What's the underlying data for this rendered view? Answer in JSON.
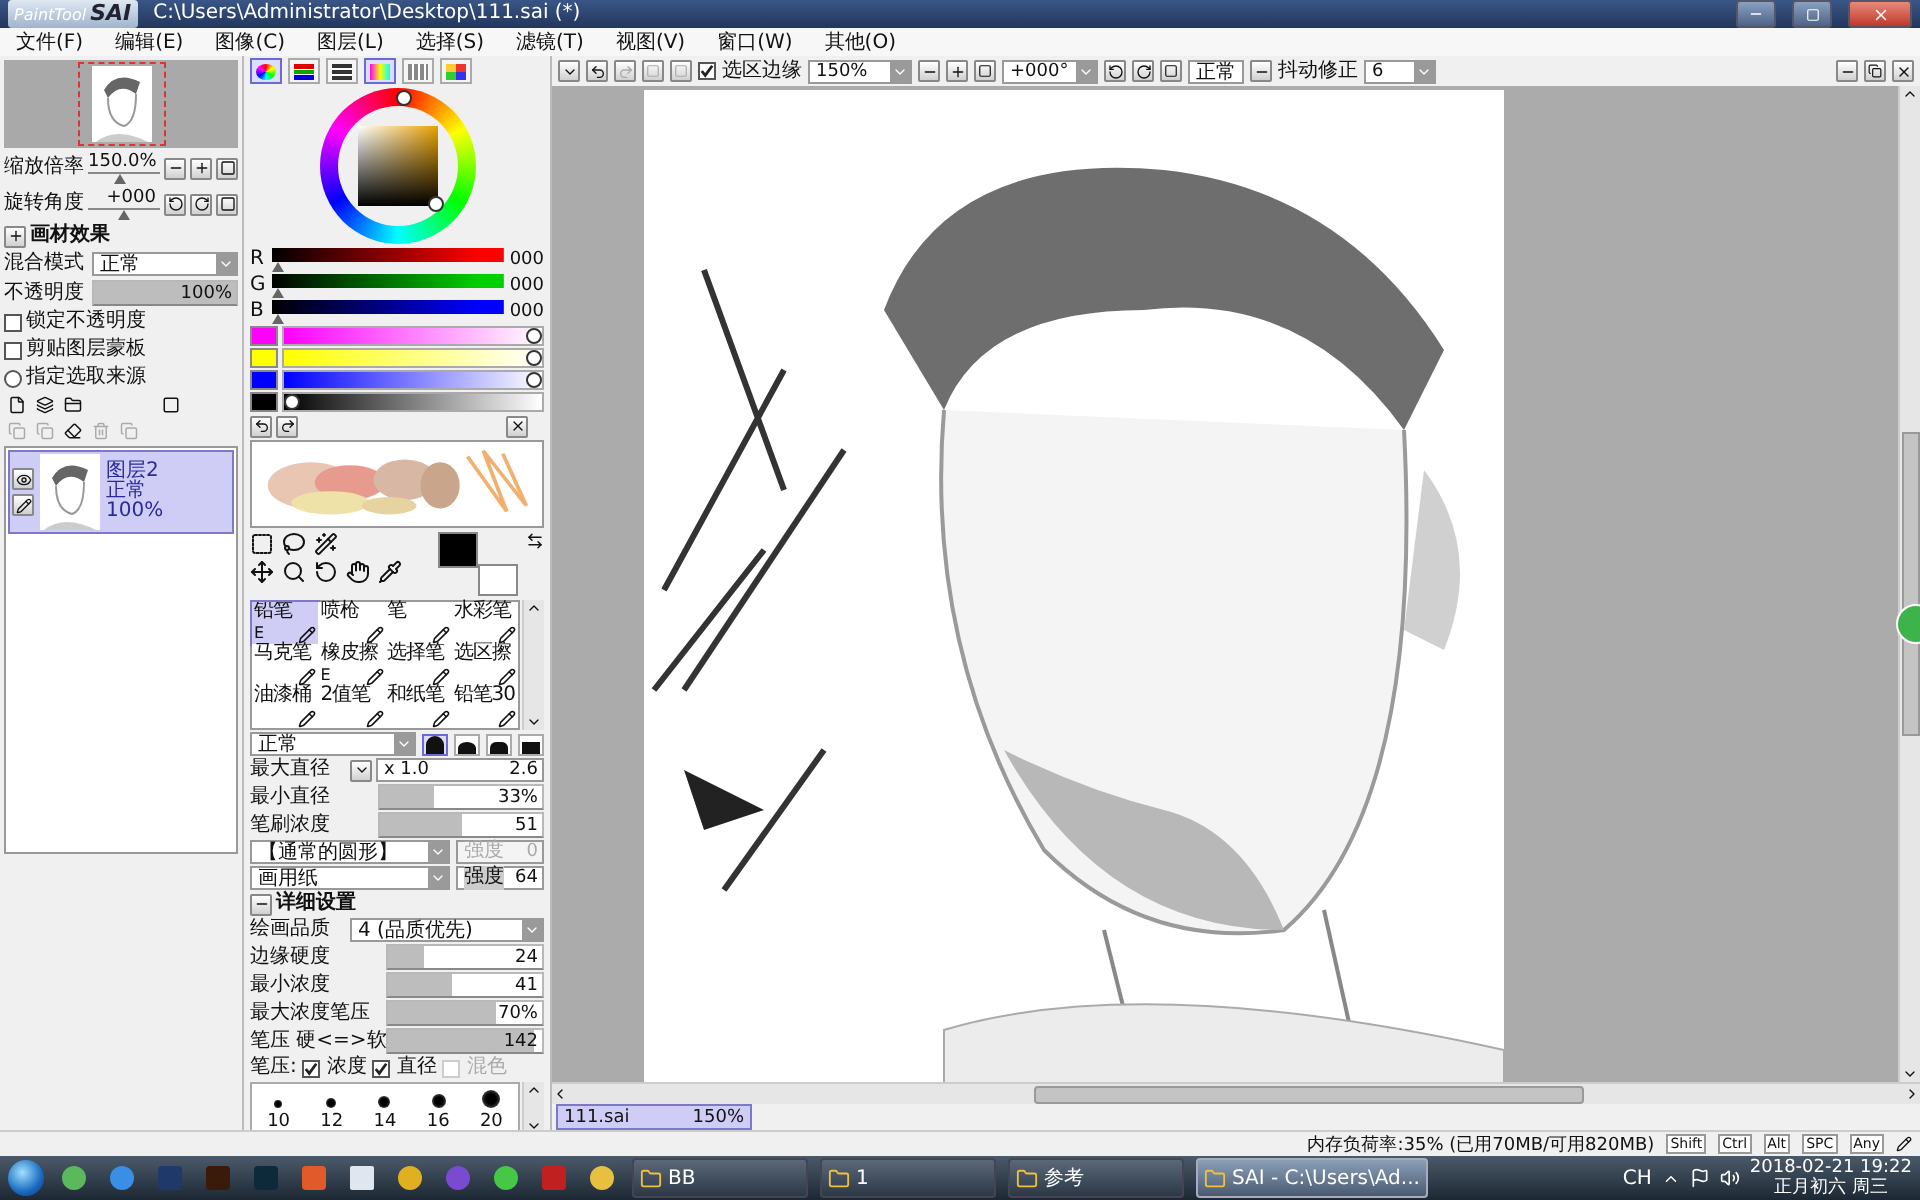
{
  "window": {
    "logo_small": "PaintTool",
    "logo_large": "SAI",
    "title": "C:\\Users\\Administrator\\Desktop\\111.sai (*)"
  },
  "menu": [
    "文件(F)",
    "编辑(E)",
    "图像(C)",
    "图层(L)",
    "选择(S)",
    "滤镜(T)",
    "视图(V)",
    "窗口(W)",
    "其他(O)"
  ],
  "navigator": {
    "zoom": {
      "label": "缩放倍率",
      "value": "150.0%",
      "level": 0.45
    },
    "angle": {
      "label": "旋转角度",
      "value": "+000",
      "level": 0.5
    }
  },
  "layer_panel": {
    "effects": "画材效果",
    "blend": {
      "label": "混合模式",
      "value": "正常"
    },
    "opacity": {
      "label": "不透明度",
      "value": "100%",
      "level": 1
    },
    "options": [
      {
        "kind": "checkbox",
        "label": "锁定不透明度",
        "checked": false
      },
      {
        "kind": "checkbox",
        "label": "剪贴图层蒙板",
        "checked": false
      },
      {
        "kind": "radio",
        "label": "指定选取来源",
        "checked": false
      }
    ],
    "layers": [
      {
        "name": "图层2",
        "mode": "正常",
        "opacity": "100%",
        "selected": true,
        "visible": true
      }
    ]
  },
  "color_panel": {
    "tabs": [
      {
        "on": true
      },
      {
        "on": false
      },
      {
        "on": false
      },
      {
        "on": true
      },
      {
        "on": false
      },
      {
        "on": false
      }
    ],
    "rgb": [
      {
        "label": "R",
        "value": "000",
        "level": 0,
        "color": "#ff0000"
      },
      {
        "label": "G",
        "value": "000",
        "level": 0,
        "color": "#00d000"
      },
      {
        "label": "B",
        "value": "000",
        "level": 0,
        "color": "#0000ff"
      }
    ],
    "bars": [
      {
        "color": "#ff00ff",
        "level": 1
      },
      {
        "color": "#ffff00",
        "level": 1
      },
      {
        "color": "#0000ff",
        "level": 1
      },
      {
        "color": "#000000",
        "level": 0
      }
    ]
  },
  "tools": [
    {
      "label": "铅笔",
      "key": "E",
      "selected": true
    },
    {
      "label": "喷枪",
      "selected": false
    },
    {
      "label": "笔",
      "selected": false
    },
    {
      "label": "水彩笔",
      "selected": false
    },
    {
      "label": "马克笔",
      "selected": false
    },
    {
      "label": "橡皮擦",
      "key": "E",
      "selected": false
    },
    {
      "label": "选择笔",
      "selected": false
    },
    {
      "label": "选区擦",
      "selected": false
    },
    {
      "label": "油漆桶",
      "selected": false
    },
    {
      "label": "2值笔",
      "selected": false
    },
    {
      "label": "和纸笔",
      "selected": false
    },
    {
      "label": "铅笔30",
      "selected": false
    }
  ],
  "brush": {
    "blend": "正常",
    "shapes": [
      {
        "selected": true
      },
      {
        "selected": false
      },
      {
        "selected": false
      },
      {
        "selected": false
      }
    ],
    "max_size": {
      "label": "最大直径",
      "multiplier": "x 1.0",
      "value": "2.6"
    },
    "sliders": [
      {
        "label": "最小直径",
        "value": "33%",
        "level": 0.33
      },
      {
        "label": "笔刷浓度",
        "value": "51",
        "level": 0.51
      }
    ],
    "shape": {
      "value": "【通常的圆形】",
      "strength_label": "强度",
      "strength": "0",
      "disabled": true
    },
    "texture": {
      "value": "画用纸",
      "strength_label": "强度",
      "strength": "64",
      "disabled": false
    },
    "details": "详细设置",
    "quality": {
      "label": "绘画品质",
      "value": "4 (品质优先)"
    },
    "detail_sliders": [
      {
        "label": "边缘硬度",
        "value": "24",
        "level": 0.24
      },
      {
        "label": "最小浓度",
        "value": "41",
        "level": 0.41
      },
      {
        "label": "最大浓度笔压",
        "value": "70%",
        "level": 0.7
      },
      {
        "label": "笔压 硬<=>软",
        "value": "142",
        "level": 0.95
      }
    ],
    "pressure": {
      "label": "笔压:",
      "options": [
        {
          "label": "浓度",
          "checked": true,
          "disabled": false
        },
        {
          "label": "直径",
          "checked": true,
          "disabled": false
        },
        {
          "label": "混色",
          "checked": false,
          "disabled": true
        }
      ]
    },
    "sizes": [
      "10",
      "12",
      "14",
      "16",
      "20"
    ]
  },
  "canvas_toolbar": {
    "selection_edge": {
      "label": "选区边缘",
      "checked": true
    },
    "zoom": "150%",
    "angle": "+000°",
    "blend": "正常",
    "stabilizer_label": "抖动修正",
    "stabilizer": "6"
  },
  "documents": [
    {
      "name": "111.sai",
      "zoom": "150%",
      "selected": true
    }
  ],
  "status": {
    "memory": "内存负荷率:35% (已用70MB/可用820MB)",
    "keys": [
      "Shift",
      "Ctrl",
      "Alt",
      "SPC",
      "Any"
    ]
  },
  "taskbar": {
    "tasks": [
      {
        "label": "BB",
        "selected": false
      },
      {
        "label": "1",
        "selected": false
      },
      {
        "label": "参考",
        "selected": false
      },
      {
        "label": "SAI - C:\\Users\\Ad...",
        "selected": true
      }
    ],
    "lang": "CH",
    "time": "2018-02-21  19:22",
    "date": "正月初六 周三"
  }
}
